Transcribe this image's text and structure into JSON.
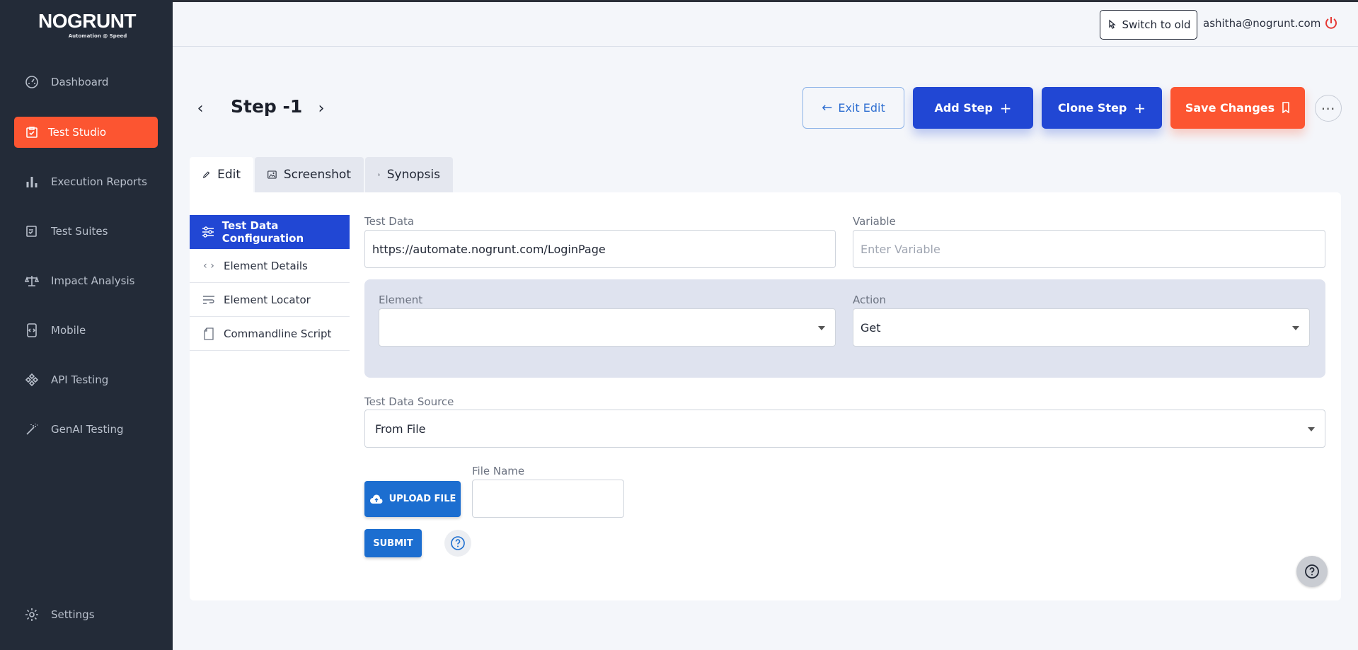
{
  "brand": {
    "name": "NOGRUNT",
    "tagline": "Automation @ Speed"
  },
  "sidebar": {
    "items": [
      {
        "label": "Dashboard",
        "icon": "gauge-icon",
        "active": false
      },
      {
        "label": "Test Studio",
        "icon": "clipboard-icon",
        "active": true
      },
      {
        "label": "Execution Reports",
        "icon": "bar-chart-icon",
        "active": false
      },
      {
        "label": "Test Suites",
        "icon": "checklist-icon",
        "active": false
      },
      {
        "label": "Impact Analysis",
        "icon": "scale-icon",
        "active": false
      },
      {
        "label": "Mobile",
        "icon": "mobile-icon",
        "active": false
      },
      {
        "label": "API Testing",
        "icon": "api-icon",
        "active": false
      },
      {
        "label": "GenAI Testing",
        "icon": "magic-wand-icon",
        "active": false
      }
    ],
    "settings_label": "Settings"
  },
  "topbar": {
    "switch_label": "Switch to old",
    "user_email": "ashitha@nogrunt.com"
  },
  "header": {
    "step_title": "Step -1",
    "exit_label": "Exit Edit",
    "add_label": "Add Step",
    "clone_label": "Clone Step",
    "save_label": "Save Changes"
  },
  "tabs": [
    {
      "label": "Edit",
      "icon": "pencil-icon",
      "active": true
    },
    {
      "label": "Screenshot",
      "icon": "image-icon",
      "active": false
    },
    {
      "label": "Synopsis",
      "icon": "document-icon",
      "active": false
    }
  ],
  "subnav": [
    {
      "label": "Test Data Configuration",
      "icon": "sliders-icon",
      "active": true
    },
    {
      "label": "Element Details",
      "icon": "code-icon",
      "active": false
    },
    {
      "label": "Element Locator",
      "icon": "wrap-text-icon",
      "active": false
    },
    {
      "label": "Commandline Script",
      "icon": "file-icon",
      "active": false
    }
  ],
  "form": {
    "test_data": {
      "label": "Test Data",
      "value": "https://automate.nogrunt.com/LoginPage"
    },
    "variable": {
      "label": "Variable",
      "placeholder": "Enter Variable",
      "value": ""
    },
    "element": {
      "label": "Element",
      "value": ""
    },
    "action": {
      "label": "Action",
      "value": "Get"
    },
    "test_data_source": {
      "label": "Test Data Source",
      "value": "From File"
    },
    "upload_label": "UPLOAD FILE",
    "file_name": {
      "label": "File Name",
      "value": ""
    },
    "submit_label": "SUBMIT"
  },
  "colors": {
    "sidebar_bg": "#232b38",
    "accent_orange": "#fc5531",
    "primary_blue": "#2147d4",
    "upload_blue": "#1c6ed0"
  }
}
